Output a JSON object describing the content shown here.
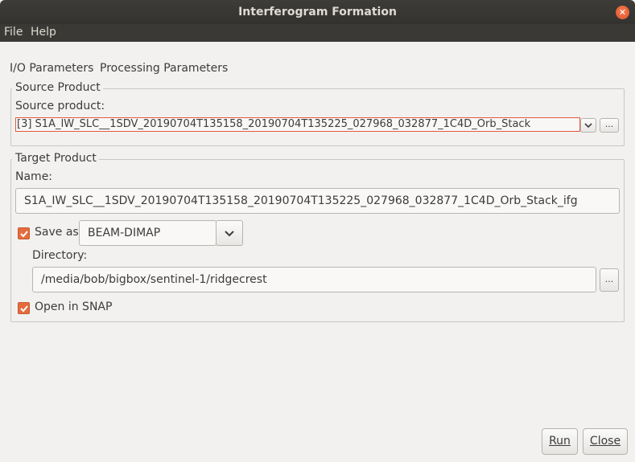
{
  "window": {
    "title": "Interferogram Formation"
  },
  "menu": [
    "File",
    "Help"
  ],
  "tabs": [
    "I/O Parameters",
    "Processing Parameters"
  ],
  "source": {
    "group_title": "Source Product",
    "label": "Source product:",
    "selected": "[3] S1A_IW_SLC__1SDV_20190704T135158_20190704T135225_027968_032877_1C4D_Orb_Stack",
    "browse_label": "..."
  },
  "target": {
    "group_title": "Target Product",
    "name_label": "Name:",
    "name_value": "S1A_IW_SLC__1SDV_20190704T135158_20190704T135225_027968_032877_1C4D_Orb_Stack_ifg",
    "save_as_label": "Save as:",
    "save_as_checked": true,
    "format": "BEAM-DIMAP",
    "directory_label": "Directory:",
    "directory_value": "/media/bob/bigbox/sentinel-1/ridgecrest",
    "browse_label": "...",
    "open_in_snap_label": "Open in SNAP",
    "open_in_snap_checked": true
  },
  "buttons": {
    "run": "Run",
    "close": "Close"
  },
  "colors": {
    "accent": "#e56b3d",
    "titlebar": "#3a3935"
  }
}
